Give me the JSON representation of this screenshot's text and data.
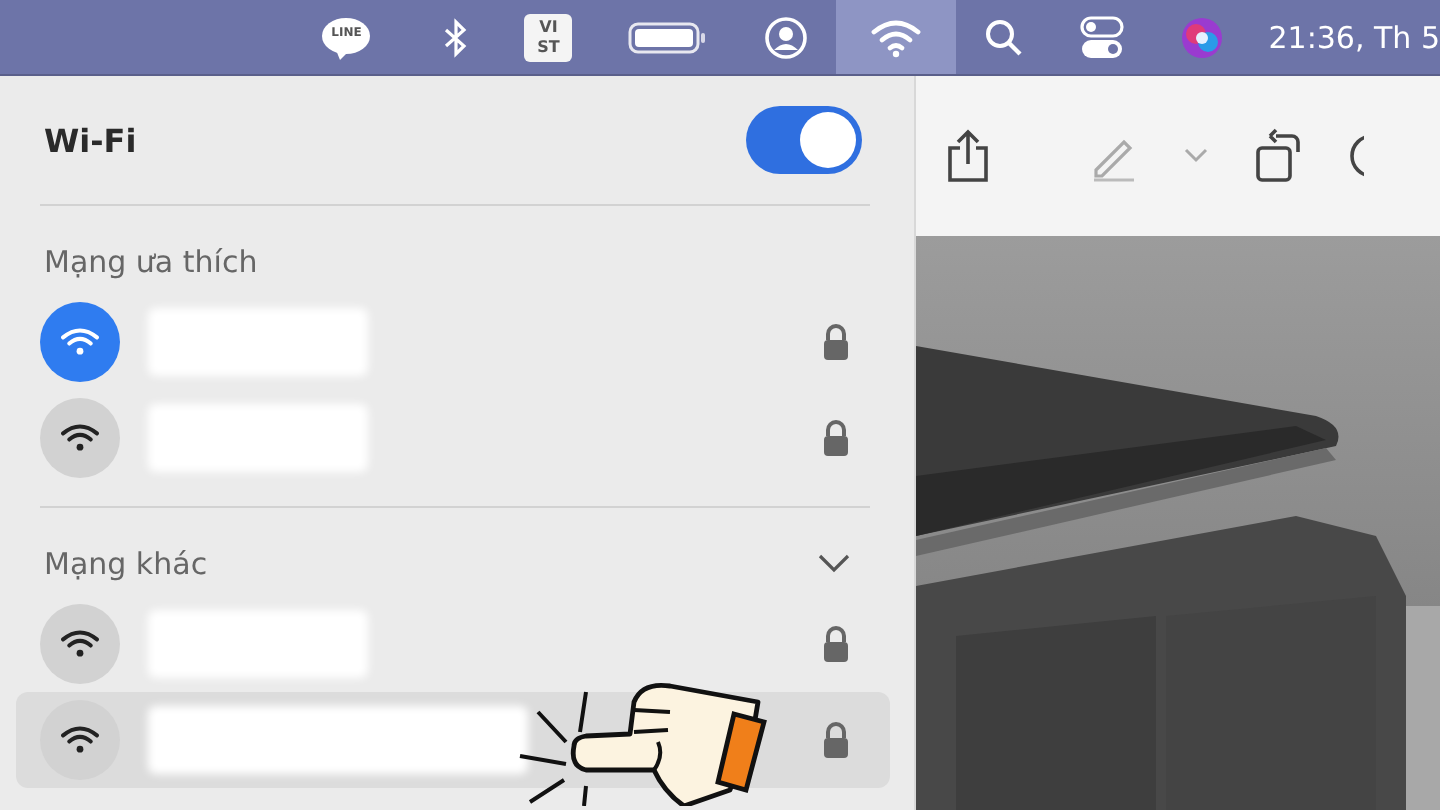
{
  "menu_bar": {
    "line_badge": "LINE",
    "input_source": "VI ST",
    "clock": "21:36, Th 5",
    "wifi_active": true
  },
  "wifi": {
    "title": "Wi-Fi",
    "on": true
  },
  "sections": [
    {
      "label": "Mạng ưa thích",
      "networks": [
        {
          "connected": true,
          "highlighted": false,
          "locked": true
        },
        {
          "connected": false,
          "highlighted": false,
          "locked": true
        }
      ]
    },
    {
      "label": "Mạng khác",
      "expanded": true,
      "networks": [
        {
          "connected": false,
          "highlighted": false,
          "locked": true
        },
        {
          "connected": false,
          "highlighted": true,
          "locked": true
        }
      ]
    }
  ]
}
